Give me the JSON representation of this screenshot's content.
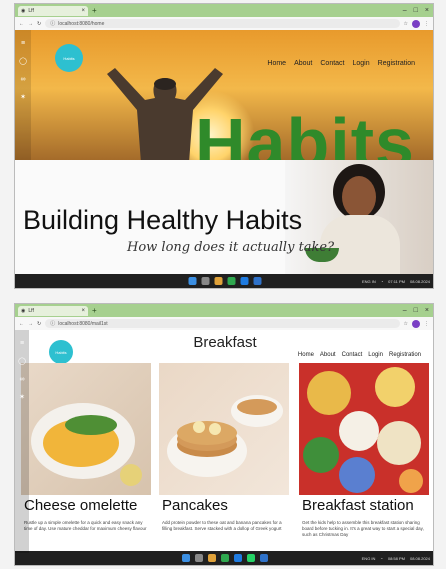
{
  "shot1": {
    "tab": {
      "title": "Lff"
    },
    "address": {
      "url": "localhost:8080/home"
    },
    "nav": [
      "Home",
      "About",
      "Contact",
      "Login",
      "Registration"
    ],
    "logo_text": "Habits",
    "hero_word": "Habits",
    "title": "Building Healthy Habits",
    "subtitle": "How long does it actually take?",
    "clock": {
      "time": "07:11 PM",
      "date": "08.08.2024"
    },
    "lang": "ENG IN"
  },
  "shot2": {
    "tab": {
      "title": "Lff"
    },
    "address": {
      "url": "localhost:8080/mail1st"
    },
    "page_title": "Breakfast",
    "nav": [
      "Home",
      "About",
      "Contact",
      "Login",
      "Registration"
    ],
    "cards": [
      {
        "title": "Cheese omelette",
        "desc": "Rustle up a simple omelette for a quick and easy snack any time of day. Use mature cheddar for maximum cheesy flavour"
      },
      {
        "title": "Pancakes",
        "desc": "Add protein powder to these oat and banana pancakes for a filling breakfast. Serve stacked with a dollop of Greek yogurt"
      },
      {
        "title": "Breakfast station",
        "desc": "Get the kids help to assemble this breakfast station sharing board before tucking in. It's a great way to start a special day, such as Christmas Day"
      }
    ],
    "clock": {
      "time": "08:58 PM",
      "date": "08.08.2024"
    },
    "lang": "ENG IN"
  },
  "colors": {
    "tabbar": "#a6d08f",
    "taskbar": "#202020",
    "habits_green": "#2f8a2a",
    "logo": "#2dc0d0"
  }
}
